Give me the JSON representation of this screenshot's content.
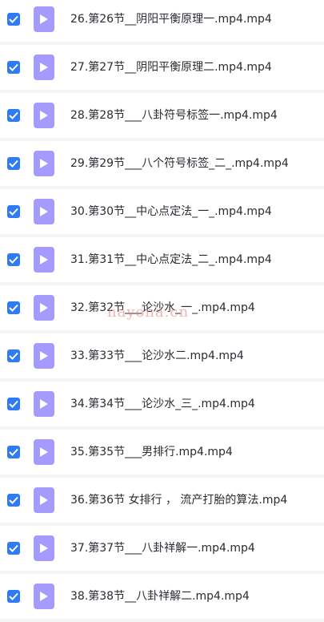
{
  "colors": {
    "checkbox": "#2f7bf5",
    "file_icon": "#a59bff",
    "row_background": "#ffffff",
    "page_background": "#f4f5f7",
    "text": "#2b2b33"
  },
  "icons": {
    "checkbox": "checkmark-icon",
    "file": "video-file-play-icon"
  },
  "files": [
    {
      "name": "26.第26节__阴阳平衡原理一.mp4.mp4",
      "checked": true
    },
    {
      "name": "27.第27节__阴阳平衡原理二.mp4.mp4",
      "checked": true
    },
    {
      "name": "28.第28节___八卦符号标签一.mp4.mp4",
      "checked": true
    },
    {
      "name": "29.第29节___八个符号标签_二_.mp4.mp4",
      "checked": true
    },
    {
      "name": "30.第30节__中心点定法_一_.mp4.mp4",
      "checked": true
    },
    {
      "name": "31.第31节__中心点定法_二_.mp4.mp4",
      "checked": true
    },
    {
      "name": "32.第32节___论沙水_一_.mp4.mp4",
      "checked": true
    },
    {
      "name": "33.第33节___论沙水二.mp4.mp4",
      "checked": true
    },
    {
      "name": "34.第34节___论沙水_三_.mp4.mp4",
      "checked": true
    },
    {
      "name": "35.第35节___男排行.mp4.mp4",
      "checked": true
    },
    {
      "name": "36.第36节 女排行 ， 流产打胎的算法.mp4",
      "checked": true
    },
    {
      "name": "37.第37节___八卦祥解一.mp4.mp4",
      "checked": true
    },
    {
      "name": "38.第38节__八卦祥解二.mp4.mp4",
      "checked": true
    }
  ],
  "watermark": "nayona.cn"
}
